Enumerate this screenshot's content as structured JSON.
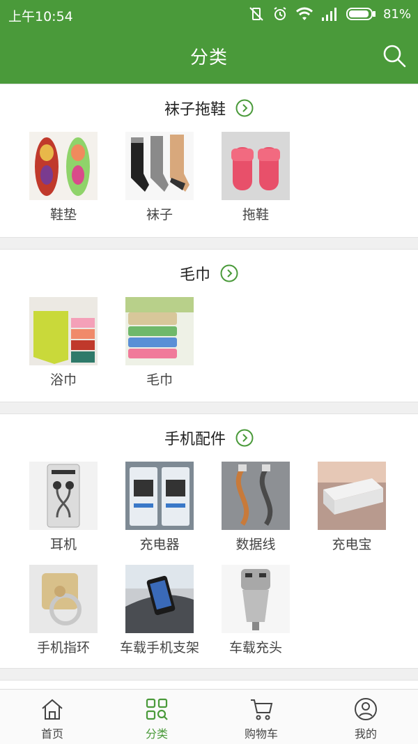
{
  "colors": {
    "brand": "#4a9a3a",
    "background": "#f0f0f0",
    "text": "#222222",
    "tab_inactive": "#444444"
  },
  "status_bar": {
    "time": "上午10:54",
    "battery_percent": "81%"
  },
  "header": {
    "title": "分类",
    "search_icon": "search-icon"
  },
  "sections": [
    {
      "title": "袜子拖鞋",
      "items": [
        {
          "label": "鞋垫"
        },
        {
          "label": "袜子"
        },
        {
          "label": "拖鞋"
        }
      ]
    },
    {
      "title": "毛巾",
      "items": [
        {
          "label": "浴巾"
        },
        {
          "label": "毛巾"
        }
      ]
    },
    {
      "title": "手机配件",
      "items": [
        {
          "label": "耳机"
        },
        {
          "label": "充电器"
        },
        {
          "label": "数据线"
        },
        {
          "label": "充电宝"
        },
        {
          "label": "手机指环"
        },
        {
          "label": "车载手机支架"
        },
        {
          "label": "车载充头"
        }
      ]
    }
  ],
  "tabs": [
    {
      "label": "首页",
      "icon": "home-icon",
      "active": false
    },
    {
      "label": "分类",
      "icon": "category-icon",
      "active": true
    },
    {
      "label": "购物车",
      "icon": "cart-icon",
      "active": false
    },
    {
      "label": "我的",
      "icon": "user-icon",
      "active": false
    }
  ]
}
